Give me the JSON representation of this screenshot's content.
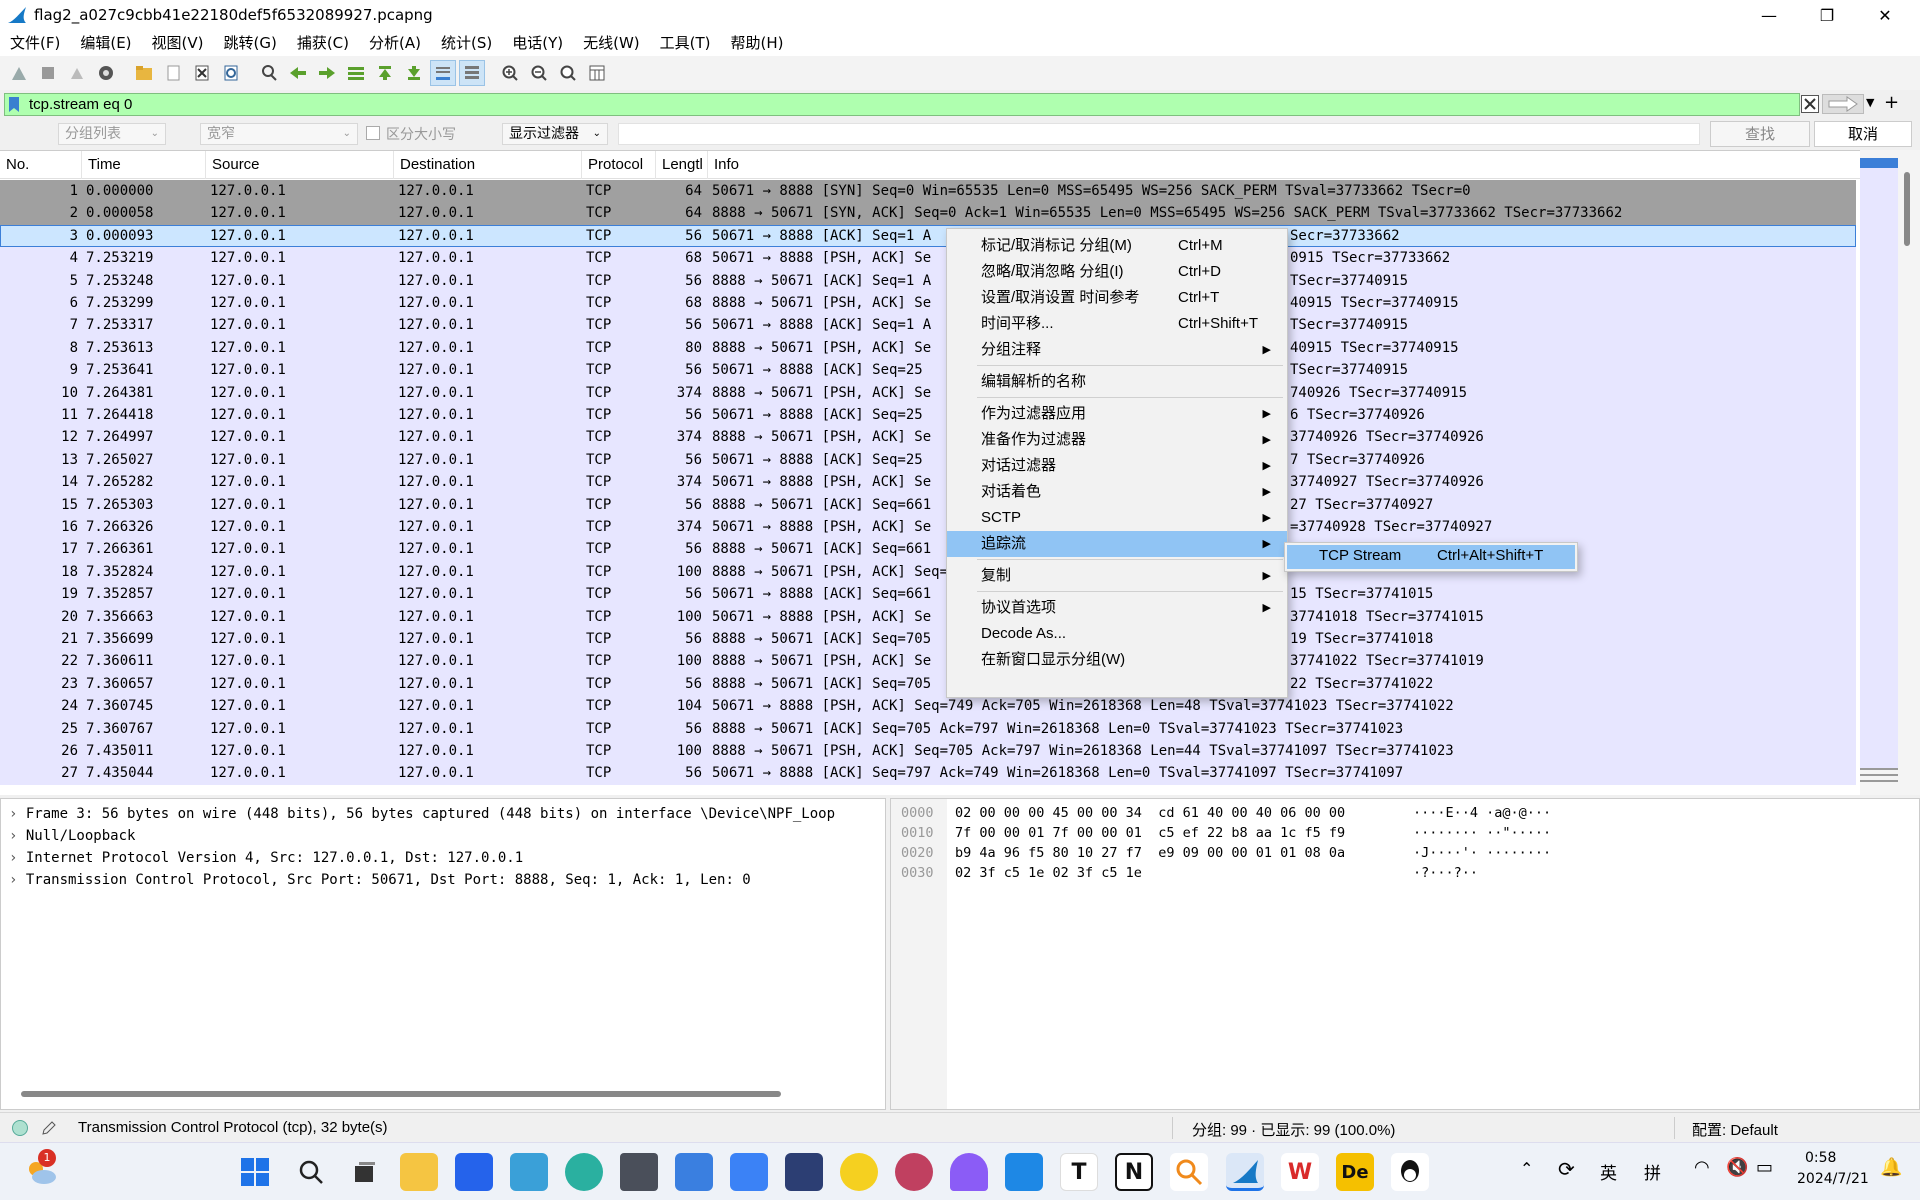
{
  "window": {
    "title": "flag2_a027c9cbb41e22180def5f6532089927.pcapng",
    "controls": [
      "minimize",
      "restore",
      "close"
    ]
  },
  "menubar": [
    "文件(F)",
    "编辑(E)",
    "视图(V)",
    "跳转(G)",
    "捕获(C)",
    "分析(A)",
    "统计(S)",
    "电话(Y)",
    "无线(W)",
    "工具(T)",
    "帮助(H)"
  ],
  "toolbar_icons": [
    "start-capture-icon",
    "stop-capture-icon",
    "restart-capture-icon",
    "capture-options-icon",
    "open-file-icon",
    "save-file-icon",
    "close-file-icon",
    "reload-icon",
    "find-packet-icon",
    "go-back-icon",
    "go-forward-icon",
    "go-to-packet-icon",
    "go-first-icon",
    "go-last-icon",
    "autoscroll-icon",
    "colorize-icon",
    "zoom-in-icon",
    "zoom-out-icon",
    "zoom-normal-icon",
    "resize-columns-icon"
  ],
  "filter": {
    "value": "tcp.stream eq 0",
    "color": "#afffaf"
  },
  "findbar": {
    "scope": "分组列表",
    "charset": "宽窄",
    "case_label": "区分大小写",
    "type": "显示过滤器",
    "find_label": "查找",
    "cancel_label": "取消"
  },
  "columns": [
    "No.",
    "Time",
    "Source",
    "Destination",
    "Protocol",
    "Lengtl",
    "Info"
  ],
  "packets": [
    {
      "no": "1",
      "time": "0.000000",
      "src": "127.0.0.1",
      "dst": "127.0.0.1",
      "proto": "TCP",
      "len": "64",
      "info": "50671 → 8888 [SYN] Seq=0 Win=65535 Len=0 MSS=65495 WS=256 SACK_PERM TSval=37733662 TSecr=0",
      "style": "gray"
    },
    {
      "no": "2",
      "time": "0.000058",
      "src": "127.0.0.1",
      "dst": "127.0.0.1",
      "proto": "TCP",
      "len": "64",
      "info": "8888 → 50671 [SYN, ACK] Seq=0 Ack=1 Win=65535 Len=0 MSS=65495 WS=256 SACK_PERM TSval=37733662 TSecr=37733662",
      "style": "gray"
    },
    {
      "no": "3",
      "time": "0.000093",
      "src": "127.0.0.1",
      "dst": "127.0.0.1",
      "proto": "TCP",
      "len": "56",
      "info": "50671 → 8888 [ACK] Seq=1 A",
      "info_tail": "Secr=37733662",
      "style": "selected"
    },
    {
      "no": "4",
      "time": "7.253219",
      "src": "127.0.0.1",
      "dst": "127.0.0.1",
      "proto": "TCP",
      "len": "68",
      "info": "50671 → 8888 [PSH, ACK] Se",
      "info_tail": "0915 TSecr=37733662",
      "style": "normal"
    },
    {
      "no": "5",
      "time": "7.253248",
      "src": "127.0.0.1",
      "dst": "127.0.0.1",
      "proto": "TCP",
      "len": "56",
      "info": "8888 → 50671 [ACK] Seq=1 A",
      "info_tail": "TSecr=37740915",
      "style": "normal"
    },
    {
      "no": "6",
      "time": "7.253299",
      "src": "127.0.0.1",
      "dst": "127.0.0.1",
      "proto": "TCP",
      "len": "68",
      "info": "8888 → 50671 [PSH, ACK] Se",
      "info_tail": "40915 TSecr=37740915",
      "style": "normal"
    },
    {
      "no": "7",
      "time": "7.253317",
      "src": "127.0.0.1",
      "dst": "127.0.0.1",
      "proto": "TCP",
      "len": "56",
      "info": "50671 → 8888 [ACK] Seq=1 A",
      "info_tail": "TSecr=37740915",
      "style": "normal"
    },
    {
      "no": "8",
      "time": "7.253613",
      "src": "127.0.0.1",
      "dst": "127.0.0.1",
      "proto": "TCP",
      "len": "80",
      "info": "8888 → 50671 [PSH, ACK] Se",
      "info_tail": "40915 TSecr=37740915",
      "style": "normal"
    },
    {
      "no": "9",
      "time": "7.253641",
      "src": "127.0.0.1",
      "dst": "127.0.0.1",
      "proto": "TCP",
      "len": "56",
      "info": "50671 → 8888 [ACK] Seq=25",
      "info_tail": " TSecr=37740915",
      "style": "normal"
    },
    {
      "no": "10",
      "time": "7.264381",
      "src": "127.0.0.1",
      "dst": "127.0.0.1",
      "proto": "TCP",
      "len": "374",
      "info": "8888 → 50671 [PSH, ACK] Se",
      "info_tail": "740926 TSecr=37740915",
      "style": "normal"
    },
    {
      "no": "11",
      "time": "7.264418",
      "src": "127.0.0.1",
      "dst": "127.0.0.1",
      "proto": "TCP",
      "len": "56",
      "info": "50671 → 8888 [ACK] Seq=25",
      "info_tail": "6 TSecr=37740926",
      "style": "normal"
    },
    {
      "no": "12",
      "time": "7.264997",
      "src": "127.0.0.1",
      "dst": "127.0.0.1",
      "proto": "TCP",
      "len": "374",
      "info": "8888 → 50671 [PSH, ACK] Se",
      "info_tail": "37740926 TSecr=37740926",
      "style": "normal"
    },
    {
      "no": "13",
      "time": "7.265027",
      "src": "127.0.0.1",
      "dst": "127.0.0.1",
      "proto": "TCP",
      "len": "56",
      "info": "50671 → 8888 [ACK] Seq=25",
      "info_tail": "7 TSecr=37740926",
      "style": "normal"
    },
    {
      "no": "14",
      "time": "7.265282",
      "src": "127.0.0.1",
      "dst": "127.0.0.1",
      "proto": "TCP",
      "len": "374",
      "info": "50671 → 8888 [PSH, ACK] Se",
      "info_tail": "37740927 TSecr=37740926",
      "style": "normal"
    },
    {
      "no": "15",
      "time": "7.265303",
      "src": "127.0.0.1",
      "dst": "127.0.0.1",
      "proto": "TCP",
      "len": "56",
      "info": "8888 → 50671 [ACK] Seq=661",
      "info_tail": "27 TSecr=37740927",
      "style": "normal"
    },
    {
      "no": "16",
      "time": "7.266326",
      "src": "127.0.0.1",
      "dst": "127.0.0.1",
      "proto": "TCP",
      "len": "374",
      "info": "50671 → 8888 [PSH, ACK] Se",
      "info_tail": "=37740928 TSecr=37740927",
      "style": "normal"
    },
    {
      "no": "17",
      "time": "7.266361",
      "src": "127.0.0.1",
      "dst": "127.0.0.1",
      "proto": "TCP",
      "len": "56",
      "info": "8888 → 50671 [ACK] Seq=661",
      "info_tail": "",
      "style": "normal"
    },
    {
      "no": "18",
      "time": "7.352824",
      "src": "127.0.0.1",
      "dst": "127.0.0.1",
      "proto": "TCP",
      "len": "100",
      "info": "8888 → 50671 [PSH, ACK] Seq=661",
      "info_tail": "",
      "style": "normal"
    },
    {
      "no": "19",
      "time": "7.352857",
      "src": "127.0.0.1",
      "dst": "127.0.0.1",
      "proto": "TCP",
      "len": "56",
      "info": "50671 → 8888 [ACK] Seq=661",
      "info_tail": "15 TSecr=37741015",
      "style": "normal"
    },
    {
      "no": "20",
      "time": "7.356663",
      "src": "127.0.0.1",
      "dst": "127.0.0.1",
      "proto": "TCP",
      "len": "100",
      "info": "50671 → 8888 [PSH, ACK] Se",
      "info_tail": "37741018 TSecr=37741015",
      "style": "normal"
    },
    {
      "no": "21",
      "time": "7.356699",
      "src": "127.0.0.1",
      "dst": "127.0.0.1",
      "proto": "TCP",
      "len": "56",
      "info": "8888 → 50671 [ACK] Seq=705",
      "info_tail": "19 TSecr=37741018",
      "style": "normal"
    },
    {
      "no": "22",
      "time": "7.360611",
      "src": "127.0.0.1",
      "dst": "127.0.0.1",
      "proto": "TCP",
      "len": "100",
      "info": "8888 → 50671 [PSH, ACK] Se",
      "info_tail": "37741022 TSecr=37741019",
      "style": "normal"
    },
    {
      "no": "23",
      "time": "7.360657",
      "src": "127.0.0.1",
      "dst": "127.0.0.1",
      "proto": "TCP",
      "len": "56",
      "info": "8888 → 50671 [ACK] Seq=705",
      "info_tail": "22 TSecr=37741022",
      "style": "normal"
    },
    {
      "no": "24",
      "time": "7.360745",
      "src": "127.0.0.1",
      "dst": "127.0.0.1",
      "proto": "TCP",
      "len": "104",
      "info": "50671 → 8888 [PSH, ACK] Seq=749 Ack=705 Win=2618368 Len=48 TSval=37741023 TSecr=37741022",
      "style": "normal"
    },
    {
      "no": "25",
      "time": "7.360767",
      "src": "127.0.0.1",
      "dst": "127.0.0.1",
      "proto": "TCP",
      "len": "56",
      "info": "8888 → 50671 [ACK] Seq=705 Ack=797 Win=2618368 Len=0 TSval=37741023 TSecr=37741023",
      "style": "normal"
    },
    {
      "no": "26",
      "time": "7.435011",
      "src": "127.0.0.1",
      "dst": "127.0.0.1",
      "proto": "TCP",
      "len": "100",
      "info": "8888 → 50671 [PSH, ACK] Seq=705 Ack=797 Win=2618368 Len=44 TSval=37741097 TSecr=37741023",
      "style": "normal"
    },
    {
      "no": "27",
      "time": "7.435044",
      "src": "127.0.0.1",
      "dst": "127.0.0.1",
      "proto": "TCP",
      "len": "56",
      "info": "50671 → 8888 [ACK] Seq=797 Ack=749 Win=2618368 Len=0 TSval=37741097 TSecr=37741097",
      "style": "normal"
    }
  ],
  "row_colors": {
    "gray": "#a0a0a0",
    "normal": "#e7e6ff",
    "selected": "#cce6ff",
    "selected_border": "#3c7fd8"
  },
  "details": [
    "Frame 3: 56 bytes on wire (448 bits), 56 bytes captured (448 bits) on interface \\Device\\NPF_Loop",
    "Null/Loopback",
    "Internet Protocol Version 4, Src: 127.0.0.1, Dst: 127.0.0.1",
    "Transmission Control Protocol, Src Port: 50671, Dst Port: 8888, Seq: 1, Ack: 1, Len: 0"
  ],
  "bytes": [
    {
      "offset": "0000",
      "hex": "02 00 00 00 45 00 00 34  cd 61 40 00 40 06 00 00",
      "ascii": "····E··4 ·a@·@···"
    },
    {
      "offset": "0010",
      "hex": "7f 00 00 01 7f 00 00 01  c5 ef 22 b8 aa 1c f5 f9",
      "ascii": "········ ··\"·····"
    },
    {
      "offset": "0020",
      "hex": "b9 4a 96 f5 80 10 27 f7  e9 09 00 00 01 01 08 0a",
      "ascii": "·J····'· ········"
    },
    {
      "offset": "0030",
      "hex": "02 3f c5 1e 02 3f c5 1e",
      "ascii": "·?···?··"
    }
  ],
  "context_menu": [
    {
      "label": "标记/取消标记 分组(M)",
      "shortcut": "Ctrl+M"
    },
    {
      "label": "忽略/取消忽略 分组(I)",
      "shortcut": "Ctrl+D"
    },
    {
      "label": "设置/取消设置 时间参考",
      "shortcut": "Ctrl+T"
    },
    {
      "label": "时间平移...",
      "shortcut": "Ctrl+Shift+T"
    },
    {
      "label": "分组注释",
      "submenu": true
    },
    {
      "sep": true
    },
    {
      "label": "编辑解析的名称"
    },
    {
      "sep": true
    },
    {
      "label": "作为过滤器应用",
      "submenu": true
    },
    {
      "label": "准备作为过滤器",
      "submenu": true
    },
    {
      "label": "对话过滤器",
      "submenu": true
    },
    {
      "label": "对话着色",
      "submenu": true
    },
    {
      "label": "SCTP",
      "submenu": true
    },
    {
      "label": "追踪流",
      "submenu": true,
      "highlight": true
    },
    {
      "sep": true
    },
    {
      "label": "复制",
      "submenu": true
    },
    {
      "sep": true
    },
    {
      "label": "协议首选项",
      "submenu": true
    },
    {
      "label": "Decode As..."
    },
    {
      "label": "在新窗口显示分组(W)"
    }
  ],
  "submenu": {
    "label": "TCP Stream",
    "shortcut": "Ctrl+Alt+Shift+T"
  },
  "status": {
    "text": "Transmission Control Protocol (tcp), 32 byte(s)",
    "packets": "分组: 99 · 已显示: 99 (100.0%)",
    "profile": "配置: Default"
  },
  "taskbar": {
    "weather_badge": "1",
    "ime": "英",
    "ime2": "拼",
    "time": "0:58",
    "date": "2024/7/21",
    "app_letters": {
      "typora": "T",
      "notion": "N",
      "wps": "W",
      "de": "De"
    }
  }
}
